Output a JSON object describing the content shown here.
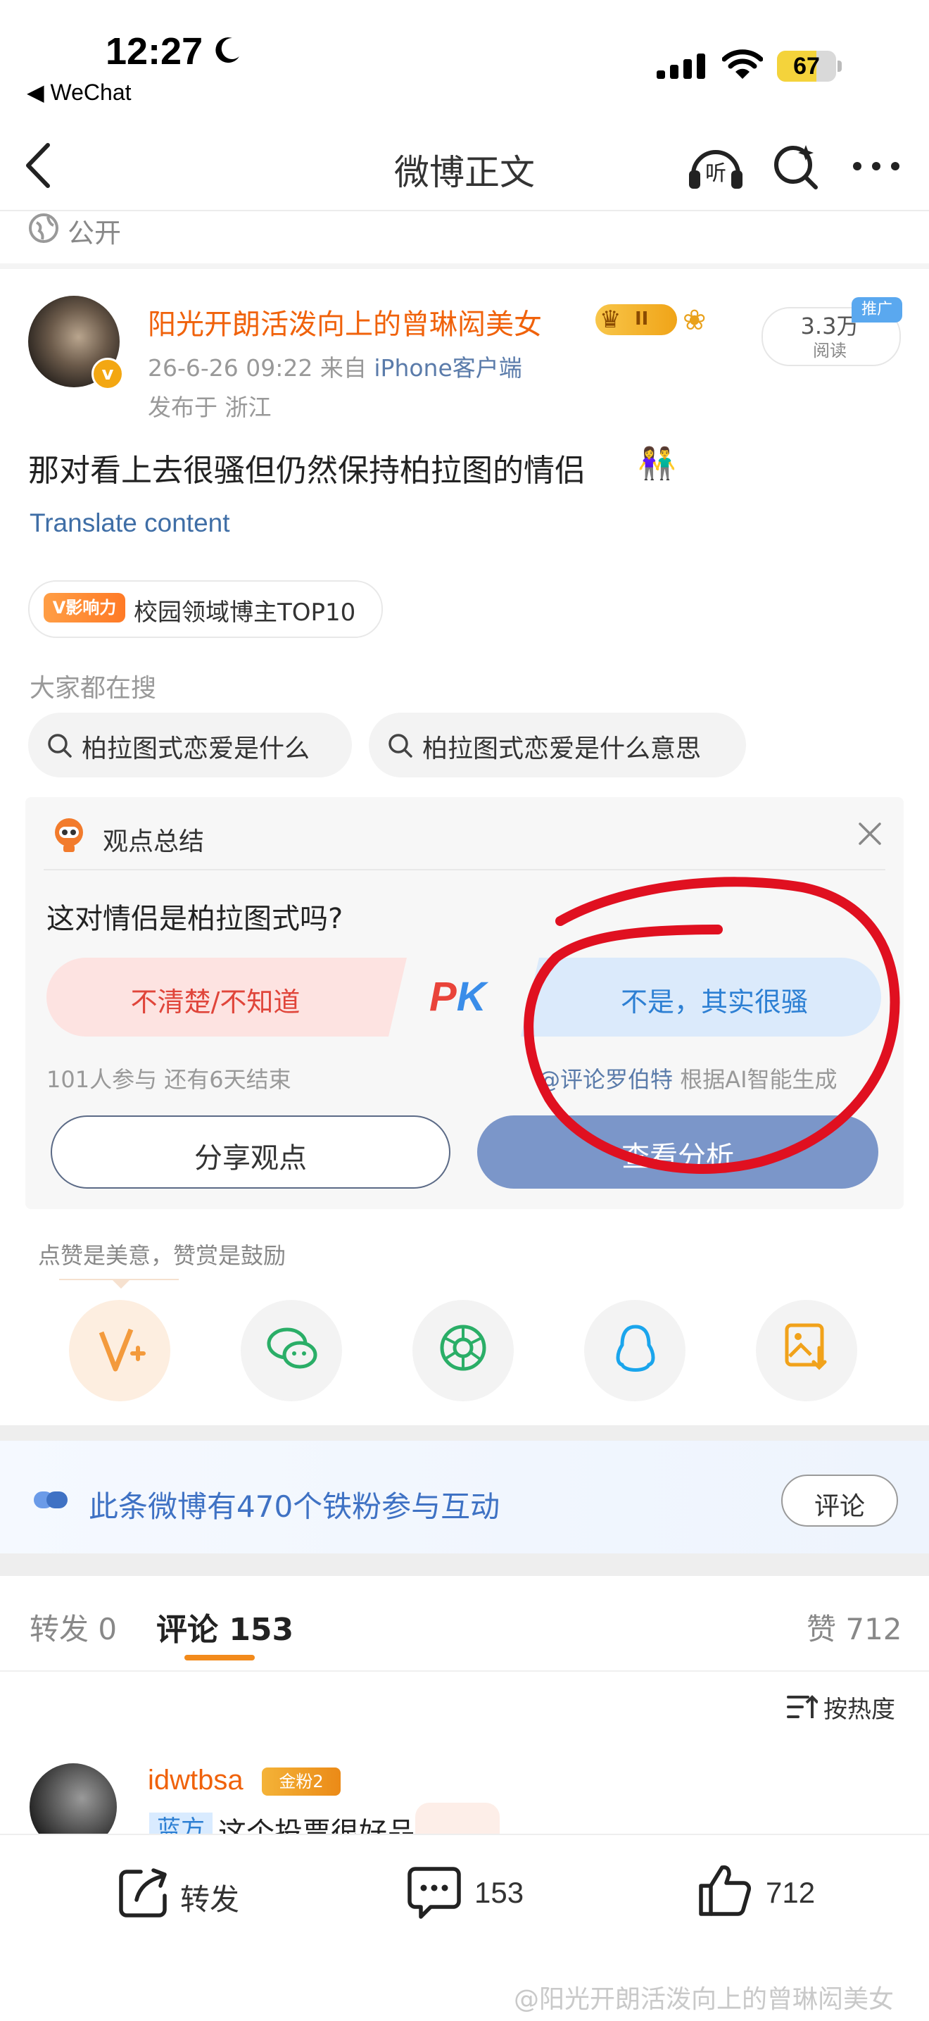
{
  "status_bar": {
    "time": "12:27",
    "back_app": "◀ WeChat",
    "battery": "67",
    "battery_level": 0.67
  },
  "nav": {
    "title": "微博正文"
  },
  "visibility": "公开",
  "post": {
    "author": "阳光开朗活泼向上的曾琳闳美女",
    "crown_level": "II",
    "meta_time": "26-6-26 09:22  来自",
    "meta_source": "iPhone客户端",
    "location": "发布于 浙江",
    "reads": "3.3万",
    "reads_label": "阅读",
    "promo_tag": "推广",
    "text": "那对看上去很骚但仍然保持柏拉图的情侣",
    "emoji": "👫",
    "translate": "Translate content",
    "influence_badge": "V影响力",
    "influence_label": "校园领域博主TOP10"
  },
  "trending": {
    "title": "大家都在搜",
    "items": [
      "柏拉图式恋爱是什么",
      "柏拉图式恋爱是什么意思"
    ]
  },
  "poll": {
    "card_title": "观点总结",
    "question": "这对情侣是柏拉图式吗?",
    "option_left": "不清楚/不知道",
    "pk_p": "P",
    "pk_k": "K",
    "option_right": "不是，其实很骚",
    "stats": "101人参与  还有6天结束",
    "credit_at": "@评论罗伯特",
    "credit_rest": " 根据AI智能生成",
    "share_btn": "分享观点",
    "analysis_btn": "查看分析"
  },
  "like_hint": "点赞是美意，赞赏是鼓励",
  "fans_banner": {
    "text": "此条微博有470个铁粉参与互动",
    "button": "评论"
  },
  "tabs": {
    "repost": "转发 0",
    "comments": "评论 153",
    "likes": "赞 712"
  },
  "sort": "按热度",
  "comment": {
    "user": "idwtbsa",
    "fan_badge": "金粉2",
    "tag": "蓝方",
    "text": "这个投票很好品"
  },
  "bottom_bar": {
    "repost": "转发",
    "comments": "153",
    "likes": "712"
  },
  "watermark": "@阳光开朗活泼向上的曾琳闳美女",
  "colors": {
    "accent": "#f0620b",
    "link": "#3f6ea6",
    "annotation": "#e01020"
  }
}
